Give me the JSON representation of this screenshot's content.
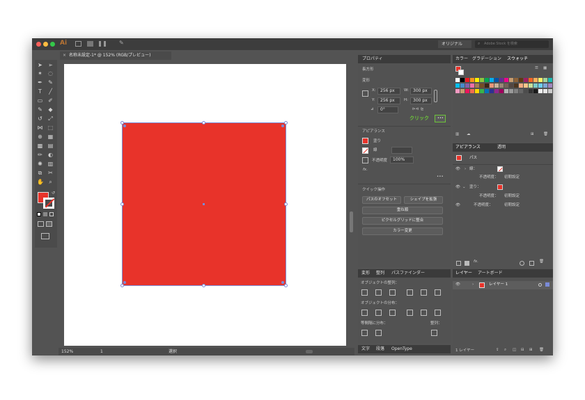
{
  "app": {
    "logo": "Ai",
    "workspace": "オリジナル",
    "stock_placeholder": "Adobe Stock を検索"
  },
  "document_tab": {
    "label": "名称未設定-1* @ 152% (RGB/プレビュー)"
  },
  "colors": {
    "red": "#e8332a",
    "canvas_bg": "#535353",
    "panel_bg": "#525252",
    "accent_green": "#6dc43a",
    "selection": "#7a8bd8"
  },
  "properties": {
    "tab": "プロパティ",
    "section_kind": "長方形",
    "transform_label": "変形",
    "x_label": "X:",
    "x": "256 px",
    "y_label": "Y:",
    "y": "256 px",
    "w_label": "W:",
    "w": "300 px",
    "h_label": "H:",
    "h": "300 px",
    "rotate": "0°",
    "click_note": "クリック",
    "more": "•••",
    "appearance_label": "アピアランス",
    "fill_label": "塗り",
    "stroke_label": "線",
    "opacity_label": "不透明度",
    "opacity": "100%",
    "fx": "fx.",
    "quick_label": "クイック操作",
    "btn_offset": "パスのオフセット",
    "btn_shape": "シェイプを拡張",
    "btn_arrange": "重ね順",
    "btn_pixel": "ピクセルグリッドに整合",
    "btn_recolor": "カラー変更"
  },
  "align_panel": {
    "tabs": [
      "変形",
      "整列",
      "パスファインダー"
    ],
    "obj_align": "オブジェクトの整列：",
    "obj_distribute": "オブジェクトの分布：",
    "spacing": "等間隔に分布：",
    "align_to": "整列："
  },
  "type_panel": {
    "tabs": [
      "文字",
      "段落",
      "OpenType"
    ]
  },
  "swatch_panel": {
    "tabs": [
      "カラー",
      "グラデーション",
      "スウォッチ"
    ],
    "colors": [
      "#ffffff",
      "#000000",
      "#ed1c24",
      "#f7941d",
      "#fff200",
      "#8dc63f",
      "#00a651",
      "#00aeef",
      "#0054a6",
      "#662d91",
      "#ec008c",
      "#c69c6d",
      "#8c6239",
      "#603913",
      "#9e1f63",
      "#f26522",
      "#fbaf5d",
      "#fff568",
      "#a3d39c",
      "#1cbbb4",
      "#00bff3",
      "#448ccb",
      "#8560a8",
      "#f06eaa",
      "#a67c52",
      "#754c24",
      "#3c2415",
      "#e9967a",
      "#c7b299",
      "#998675",
      "#736357",
      "#534741",
      "#4b3621",
      "#f9ad81",
      "#fdc689",
      "#c4df9b",
      "#7accc8",
      "#6dcff6",
      "#7ea7d8",
      "#a186be",
      "#f49ac1",
      "#c69c6d",
      "#ed145b",
      "#f26c4f",
      "#ffd700",
      "#39b54a",
      "#0072bc",
      "#2e3192",
      "#92278f",
      "#9e005d",
      "#b3b3b3",
      "#999999",
      "#808080",
      "#666666",
      "#4d4d4d",
      "#333333",
      "#1a1a1a",
      "#f2f2f2",
      "#e6e6e6",
      "#cccccc"
    ]
  },
  "appearance_panel": {
    "tabs": [
      "アピアランス",
      "透明"
    ],
    "object": "パス",
    "stroke_row": "線：",
    "fill_row": "塗り：",
    "opacity_label": "不透明度：",
    "opacity_value": "初期設定"
  },
  "layers_panel": {
    "tabs": [
      "レイヤー",
      "アートボード"
    ],
    "layer_name": "レイヤー 1",
    "count": "1 レイヤー"
  },
  "status": {
    "zoom": "152%",
    "artboard": "1",
    "tool": "選択"
  },
  "shape": {
    "color": "#e8332a"
  }
}
